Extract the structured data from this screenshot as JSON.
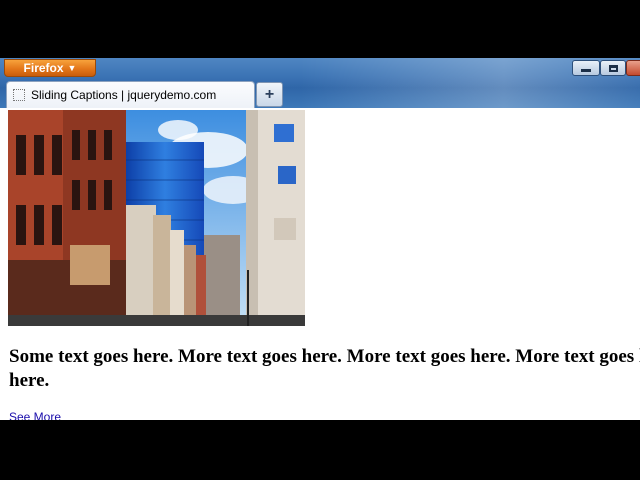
{
  "browser": {
    "menu_button_label": "Firefox",
    "tab_title": "Sliding Captions | jquerydemo.com",
    "new_tab_symbol": "+",
    "colors": {
      "menu_button": "#e3771a",
      "titlebar": "#3c74b5"
    }
  },
  "page": {
    "paragraph_line1": "Some text goes here. More text goes here. More text goes here. More text goes here.",
    "paragraph_line2": "here.",
    "link_label": "See More",
    "link_color": "#1a0dab"
  }
}
